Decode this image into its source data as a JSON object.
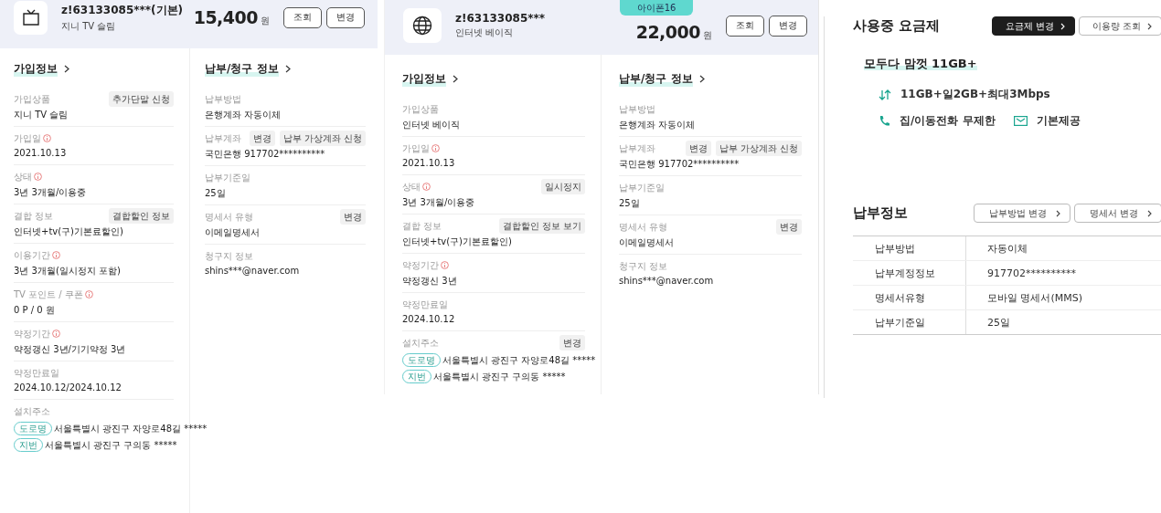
{
  "services": [
    {
      "kind": "tv",
      "id": "z!63133085***(기본)",
      "product": "지니 TV 슬림",
      "price": "15,400",
      "unit": "원",
      "buttons": [
        "조회",
        "변경"
      ],
      "join": {
        "title": "가입정보",
        "rows": [
          {
            "label": "가입상품",
            "info": false,
            "value": "지니 TV 슬림",
            "actions": [
              "추가단말 신청"
            ]
          },
          {
            "label": "가입일",
            "info": true,
            "value": "2021.10.13"
          },
          {
            "label": "상태",
            "info": true,
            "value": "3년 3개월/이용중"
          },
          {
            "label": "결합 정보",
            "info": false,
            "value": "인터넷+tv(구)기본료할인)",
            "actions": [
              "결합할인 정보"
            ]
          },
          {
            "label": "이용기간",
            "info": true,
            "value": "3년 3개월(일시정지 포함)"
          },
          {
            "label": "TV 포인트 / 쿠폰",
            "info": true,
            "value": "0 P / 0 원"
          },
          {
            "label": "약정기간",
            "info": true,
            "value": "약정갱신 3년/기기약정 3년"
          },
          {
            "label": "약정만료일",
            "info": false,
            "value": "2024.10.12/2024.10.12"
          },
          {
            "label": "설치주소",
            "info": false,
            "address": [
              {
                "tag": "도로명",
                "text": "서울특별시 광진구 자양로48길 *****"
              },
              {
                "tag": "지번",
                "text": "서울특별시 광진구 구의동 *****"
              }
            ]
          }
        ]
      },
      "billing": {
        "title": "납부/청구 정보",
        "rows": [
          {
            "label": "납부방법",
            "info": false,
            "value": "은행계좌 자동이체"
          },
          {
            "label": "납부계좌",
            "info": false,
            "value": "국민은행 917702**********",
            "actions": [
              "변경",
              "납부 가상계좌 신청"
            ]
          },
          {
            "label": "납부기준일",
            "info": false,
            "value": "25일"
          },
          {
            "label": "명세서 유형",
            "info": false,
            "value": "이메일명세서",
            "actions": [
              "변경"
            ]
          },
          {
            "label": "청구지 정보",
            "info": false,
            "value": "shins***@naver.com"
          }
        ]
      }
    },
    {
      "kind": "globe",
      "badge": "아이폰16",
      "id": "z!63133085***",
      "product": "인터넷 베이직",
      "price": "22,000",
      "unit": "원",
      "buttons": [
        "조회",
        "변경"
      ],
      "join": {
        "title": "가입정보",
        "rows": [
          {
            "label": "가입상품",
            "info": false,
            "value": "인터넷 베이직"
          },
          {
            "label": "가입일",
            "info": true,
            "value": "2021.10.13"
          },
          {
            "label": "상태",
            "info": true,
            "value": "3년 3개월/이용중",
            "actions": [
              "일시정지"
            ]
          },
          {
            "label": "결합 정보",
            "info": false,
            "value": "인터넷+tv(구)기본료할인)",
            "actions": [
              "결합할인 정보 보기"
            ]
          },
          {
            "label": "약정기간",
            "info": true,
            "value": "약정갱신 3년"
          },
          {
            "label": "약정만료일",
            "info": false,
            "value": "2024.10.12"
          },
          {
            "label": "설치주소",
            "info": false,
            "actions": [
              "변경"
            ],
            "address": [
              {
                "tag": "도로명",
                "text": "서울특별시 광진구 자양로48길 *****"
              },
              {
                "tag": "지번",
                "text": "서울특별시 광진구 구의동 *****"
              }
            ]
          }
        ]
      },
      "billing": {
        "title": "납부/청구 정보",
        "rows": [
          {
            "label": "납부방법",
            "info": false,
            "value": "은행계좌 자동이체"
          },
          {
            "label": "납부계좌",
            "info": false,
            "value": "국민은행 917702**********",
            "actions": [
              "변경",
              "납부 가상계좌 신청"
            ]
          },
          {
            "label": "납부기준일",
            "info": false,
            "value": "25일"
          },
          {
            "label": "명세서 유형",
            "info": false,
            "value": "이메일명세서",
            "actions": [
              "변경"
            ]
          },
          {
            "label": "청구지 정보",
            "info": false,
            "value": "shins***@naver.com"
          }
        ]
      }
    }
  ],
  "plan": {
    "title": "사용중 요금제",
    "buttons": [
      {
        "label": "요금제 변경",
        "kind": "primary"
      },
      {
        "label": "이용량 조회",
        "kind": "outline"
      }
    ],
    "name": "모두다 맘껏 11GB+",
    "features": [
      [
        {
          "kind": "data",
          "text": "11GB+일2GB+최대3Mbps"
        }
      ],
      [
        {
          "kind": "call",
          "text": "집/이동전화 무제한"
        },
        {
          "kind": "message",
          "text": "기본제공"
        }
      ]
    ]
  },
  "payment": {
    "title": "납부정보",
    "buttons": [
      "납부방법 변경",
      "명세서 변경"
    ],
    "rows": [
      {
        "label": "납부방법",
        "value": "자동이체"
      },
      {
        "label": "납부계정정보",
        "value": "917702**********"
      },
      {
        "label": "명세서유형",
        "value": "모바일 명세서(MMS)"
      },
      {
        "label": "납부기준일",
        "value": "25일"
      }
    ]
  }
}
